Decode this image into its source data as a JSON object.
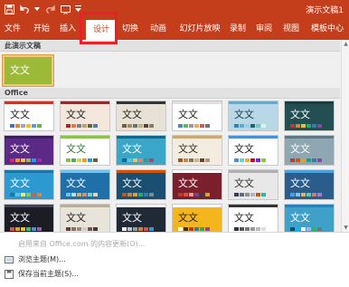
{
  "window": {
    "title": "演示文稿1"
  },
  "colors": {
    "brand": "#c43e1c",
    "highlight_box": "#e8202a",
    "selected_border": "#f7c57a"
  },
  "quick_access": [
    {
      "icon": "save-icon"
    },
    {
      "icon": "undo-icon"
    },
    {
      "icon": "undo-dropdown-icon"
    },
    {
      "icon": "redo-icon"
    },
    {
      "icon": "start-slideshow-icon"
    },
    {
      "icon": "customize-qat-icon"
    }
  ],
  "tabs": [
    {
      "label": "文件"
    },
    {
      "label": "开始"
    },
    {
      "label": "插入"
    },
    {
      "label": "设计"
    },
    {
      "label": "切换"
    },
    {
      "label": "动画"
    },
    {
      "label": "幻灯片放映"
    },
    {
      "label": "录制"
    },
    {
      "label": "审阅"
    },
    {
      "label": "视图"
    },
    {
      "label": "模板中心"
    }
  ],
  "active_tab": "设计",
  "gallery": {
    "this_presentation_header": "此演示文稿",
    "office_header": "Office",
    "thumbnail_text": "文文",
    "current_theme": {
      "text": "文文",
      "bg": "#9cba38",
      "fg": "#ffffff"
    },
    "themes": [
      {
        "text": "文文",
        "bg": "#ffffff",
        "fg": "#222222",
        "accent": "#c0392b",
        "swatches": [
          "#4472c4",
          "#ed7d31",
          "#a5a5a5",
          "#ffc000",
          "#5b9bd5",
          "#70ad47"
        ]
      },
      {
        "text": "文文",
        "bg": "#f5e7dc",
        "fg": "#222222",
        "accent": "#8b2e2e",
        "swatches": [
          "#b22222",
          "#e07b39",
          "#7f7f7f",
          "#c0a070",
          "#556b2f",
          "#4682b4"
        ]
      },
      {
        "text": "文文",
        "bg": "#e8e2d6",
        "fg": "#222222",
        "accent": "#333333",
        "swatches": [
          "#7a5c3c",
          "#a98b5d",
          "#6e6e6e",
          "#c7b07a",
          "#5c4033",
          "#8c7b5a"
        ]
      },
      {
        "text": "文文",
        "bg": "#ffffff",
        "fg": "#222222",
        "accent": "#e0e0e0",
        "swatches": [
          "#4a90a4",
          "#5cb85c",
          "#999999",
          "#f0ad4e",
          "#d9534f",
          "#6c757d"
        ]
      },
      {
        "text": "文文",
        "bg": "#b8d8e8",
        "fg": "#1a3c4a",
        "accent": "#6aa8c8",
        "swatches": [
          "#2e86ab",
          "#4bb3d6",
          "#9ad0e6",
          "#16697a",
          "#76c7c0",
          "#e0f3f8"
        ]
      },
      {
        "text": "文文",
        "bg": "#234e52",
        "fg": "#ffffff",
        "accent": "#1b3b3e",
        "swatches": [
          "#c0392b",
          "#e67e22",
          "#f1c40f",
          "#27ae60",
          "#2980b9",
          "#8e44ad"
        ]
      },
      {
        "text": "文文",
        "bg": "#5b2a86",
        "fg": "#ffffff",
        "accent": "#3e1d5c",
        "swatches": [
          "#e91e63",
          "#ff9800",
          "#ffc107",
          "#8bc34a",
          "#03a9f4",
          "#9c27b0"
        ]
      },
      {
        "text": "文文",
        "bg": "#ffffff",
        "fg": "#2e7d32",
        "accent": "#8bc34a",
        "swatches": [
          "#8bc34a",
          "#4caf50",
          "#cddc39",
          "#ff9800",
          "#03a9f4",
          "#795548"
        ]
      },
      {
        "text": "文文",
        "bg": "#3aa7c9",
        "fg": "#ffffff",
        "accent": "#0d6a8a",
        "swatches": [
          "#0d6a8a",
          "#64c1dd",
          "#f2c14e",
          "#f78154",
          "#4d9078",
          "#b4436c"
        ]
      },
      {
        "text": "文文",
        "bg": "#f3ede0",
        "fg": "#3a2a1a",
        "accent": "#c9a96e",
        "swatches": [
          "#a0522d",
          "#cd853f",
          "#8b7355",
          "#d2b48c",
          "#6b4226",
          "#bc8f8f"
        ]
      },
      {
        "text": "文文",
        "bg": "#ffffff",
        "fg": "#222222",
        "accent": "#4a90d9",
        "swatches": [
          "#4a90d9",
          "#50e3c2",
          "#f5a623",
          "#d0021b",
          "#9013fe",
          "#7ed321"
        ]
      },
      {
        "text": "文文",
        "bg": "#8fa6b3",
        "fg": "#ffffff",
        "accent": "#5d7785",
        "swatches": [
          "#c0392b",
          "#d35400",
          "#f39c12",
          "#16a085",
          "#2980b9",
          "#8e44ad"
        ]
      },
      {
        "text": "文文",
        "bg": "#2c9ad1",
        "fg": "#ffffff",
        "accent": "#1b75a8",
        "swatches": [
          "#1b75a8",
          "#5bc0eb",
          "#fde74c",
          "#9bc53d",
          "#e55934",
          "#fa7921"
        ]
      },
      {
        "text": "文文",
        "bg": "#1f6fa8",
        "fg": "#ffffff",
        "accent": "#6ec3f0",
        "swatches": [
          "#6ec3f0",
          "#b3e0f7",
          "#f2a541",
          "#f08a4b",
          "#7dcfb6",
          "#fbd1a2"
        ]
      },
      {
        "text": "文文",
        "bg": "#1b4f72",
        "fg": "#ffffff",
        "accent": "#d35400",
        "swatches": [
          "#d35400",
          "#e67e22",
          "#f39c12",
          "#27ae60",
          "#2980b9",
          "#7f8c8d"
        ]
      },
      {
        "text": "文文",
        "bg": "#7a1f2b",
        "fg": "#ffffff",
        "accent": "#ffffff",
        "swatches": [
          "#c0392b",
          "#e74c3c",
          "#f1948a",
          "#7d3c98",
          "#2e4053",
          "#d4ac0d"
        ]
      },
      {
        "text": "文文",
        "bg": "#e8e8e8",
        "fg": "#333333",
        "accent": "#b0b0b0",
        "swatches": [
          "#2e4053",
          "#5d6d7e",
          "#85929e",
          "#aeb6bf",
          "#d35400",
          "#1abc9c"
        ]
      },
      {
        "text": "文文",
        "bg": "#2a5d8c",
        "fg": "#ffffff",
        "accent": "#4aa3df",
        "swatches": [
          "#4aa3df",
          "#7fc4ef",
          "#f5b041",
          "#58d68d",
          "#ec7063",
          "#af7ac5"
        ]
      },
      {
        "text": "文文",
        "bg": "#1c1c24",
        "fg": "#ffffff",
        "accent": "#444455",
        "swatches": [
          "#e74c3c",
          "#f39c12",
          "#f1c40f",
          "#2ecc71",
          "#3498db",
          "#9b59b6"
        ]
      },
      {
        "text": "文文",
        "bg": "#e9e4da",
        "fg": "#222222",
        "accent": "#b7ad98",
        "swatches": [
          "#5d4037",
          "#8d6e63",
          "#a1887f",
          "#d7ccc8",
          "#795548",
          "#4e342e"
        ]
      },
      {
        "text": "文文",
        "bg": "#1f2a36",
        "fg": "#ffffff",
        "accent": "#f5f5f5",
        "swatches": [
          "#f5f5f5",
          "#bdc3c7",
          "#95a5a6",
          "#e67e22",
          "#e74c3c",
          "#3498db"
        ]
      },
      {
        "text": "文文",
        "bg": "#f5b51c",
        "fg": "#222222",
        "accent": "#ffffff",
        "swatches": [
          "#ffffff",
          "#333333",
          "#c0392b",
          "#2980b9",
          "#27ae60",
          "#8e44ad"
        ]
      },
      {
        "text": "文文",
        "bg": "#ffffff",
        "fg": "#222222",
        "accent": "#333333",
        "swatches": [
          "#333333",
          "#555555",
          "#777777",
          "#999999",
          "#bbbbbb",
          "#dddddd"
        ]
      },
      {
        "text": "文文",
        "bg": "#3fa0c8",
        "fg": "#ffffff",
        "accent": "#2980b9",
        "swatches": [
          "#0b4f6c",
          "#01baef",
          "#fbfbff",
          "#b4adea",
          "#20bf55",
          "#757575"
        ]
      }
    ]
  },
  "menu": {
    "items": [
      {
        "label": "启用来自 Office.com 的内容更新(O)...",
        "icon": "",
        "disabled": true
      },
      {
        "label": "浏览主题(M)...",
        "icon": "browse-themes-icon",
        "disabled": false
      },
      {
        "label": "保存当前主题(S)...",
        "icon": "save-theme-icon",
        "disabled": false
      }
    ]
  }
}
